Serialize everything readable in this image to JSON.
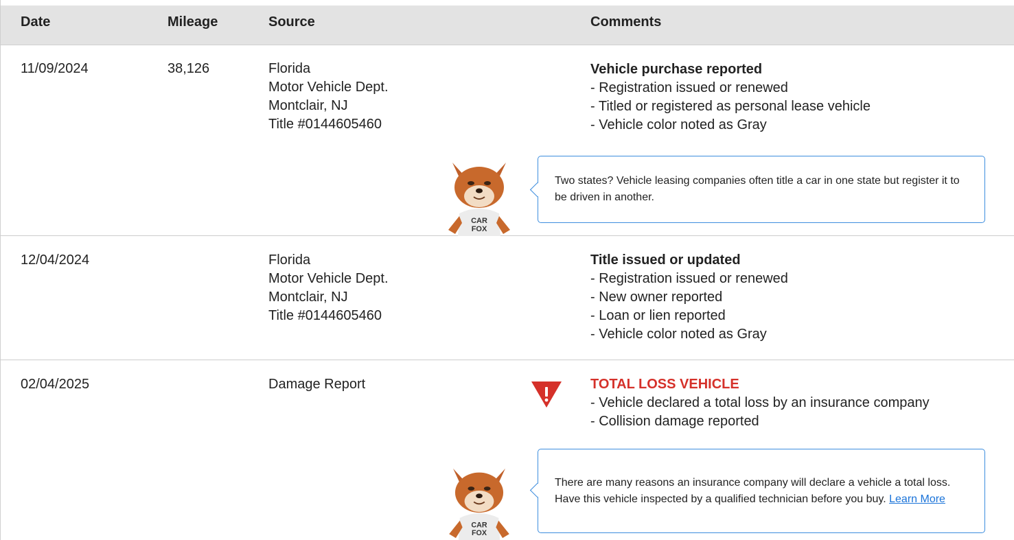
{
  "columns": {
    "date": "Date",
    "mileage": "Mileage",
    "source": "Source",
    "comments": "Comments"
  },
  "rows": [
    {
      "date": "11/09/2024",
      "mileage": "38,126",
      "source": [
        "Florida",
        "Motor Vehicle Dept.",
        "Montclair, NJ",
        "Title #0144605460"
      ],
      "heading": "Vehicle purchase reported",
      "items": [
        "- Registration issued or renewed",
        "- Titled or registered as personal lease vehicle",
        "- Vehicle color noted as Gray"
      ],
      "tip": "Two states? Vehicle leasing companies often title a car in one state but register it to be driven in another."
    },
    {
      "date": "12/04/2024",
      "mileage": "",
      "source": [
        "Florida",
        "Motor Vehicle Dept.",
        "Montclair, NJ",
        "Title #0144605460"
      ],
      "heading": "Title issued or updated",
      "items": [
        "- Registration issued or renewed",
        "- New owner reported",
        "- Loan or lien reported",
        "- Vehicle color noted as Gray"
      ]
    },
    {
      "date": "02/04/2025",
      "mileage": "",
      "source": [
        "Damage Report"
      ],
      "heading": "TOTAL LOSS VEHICLE",
      "heading_color": "#d5312a",
      "alert_icon": "warning-triangle-icon",
      "items": [
        "- Vehicle declared a total loss by an insurance company",
        "- Collision damage reported"
      ],
      "tip": "There are many reasons an insurance company will declare a vehicle a total loss. Have this vehicle inspected by a qualified technician before you buy.",
      "tip_link": "Learn More"
    }
  ],
  "mascot": {
    "shirt_line1": "CAR",
    "shirt_line2": "FOX",
    "icon": "carfox-mascot-icon"
  },
  "colors": {
    "header_bg": "#e3e3e3",
    "tip_border": "#3c8dde",
    "link": "#1a73d9",
    "alert": "#d5312a"
  }
}
